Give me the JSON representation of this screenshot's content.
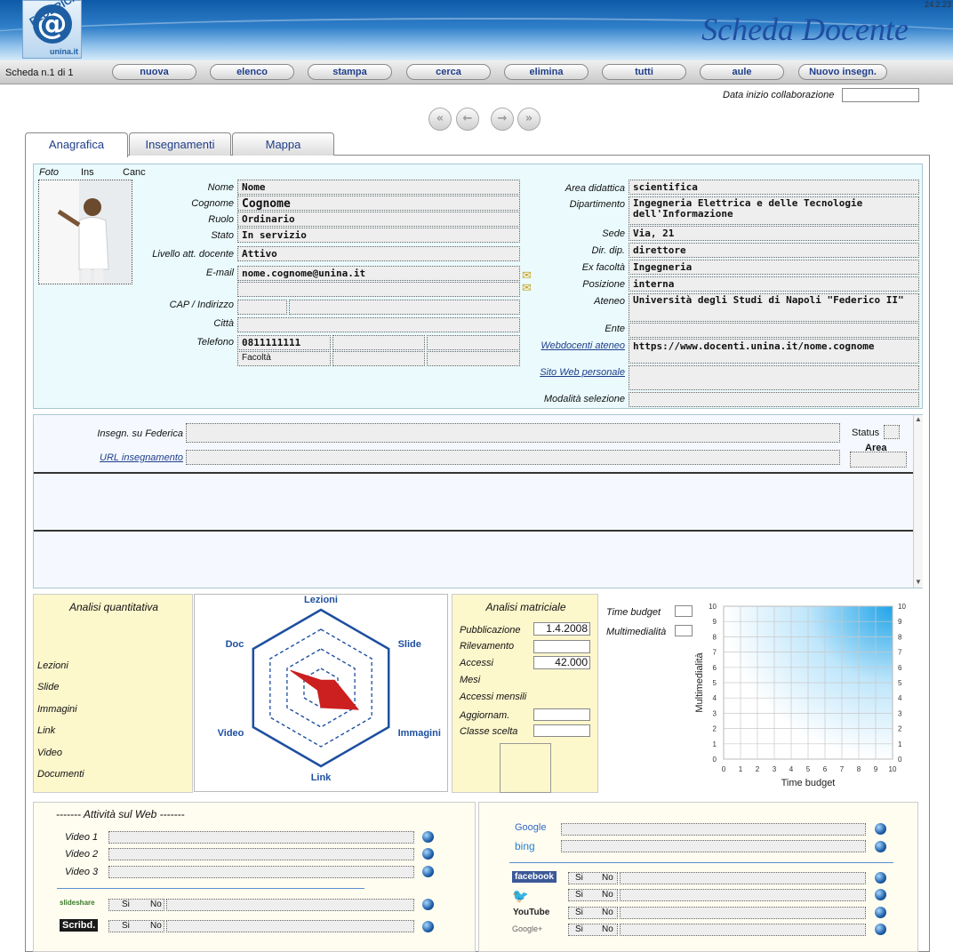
{
  "app": {
    "version": "24.2.23",
    "title": "Scheda Docente",
    "logo_top": "FEDERICA",
    "logo_bottom": "unina.it",
    "logo_glyph": "@"
  },
  "toolbar": {
    "record_label": "Scheda n.1  di 1",
    "buttons": [
      "nuova",
      "elenco",
      "stampa",
      "cerca",
      "elimina",
      "tutti",
      "aule",
      "Nuovo insegn."
    ]
  },
  "date_label": "Data inizio collaborazione",
  "nav_icons": [
    "first-record-icon",
    "prev-record-icon",
    "next-record-icon",
    "last-record-icon"
  ],
  "tabs": [
    "Anagrafica",
    "Insegnamenti",
    "Mappa"
  ],
  "photo": {
    "labels": [
      "Foto",
      "Ins",
      "Canc"
    ]
  },
  "left_fields": {
    "nome": {
      "label": "Nome",
      "value": "Nome"
    },
    "cognome": {
      "label": "Cognome",
      "value": "Cognome"
    },
    "ruolo": {
      "label": "Ruolo",
      "value": "Ordinario"
    },
    "stato": {
      "label": "Stato",
      "value": "In servizio"
    },
    "livello": {
      "label": "Livello att. docente",
      "value": "Attivo"
    },
    "email": {
      "label": "E-mail",
      "value": "nome.cognome@unina.it"
    },
    "cap": {
      "label": "CAP / Indirizzo"
    },
    "citta": {
      "label": "Città"
    },
    "telefono": {
      "label": "Telefono",
      "value": "0811111111",
      "sub": "Facoltà"
    }
  },
  "right_fields": {
    "area": {
      "label": "Area didattica",
      "value": "scientifica"
    },
    "dip": {
      "label": "Dipartimento",
      "value": "Ingegneria Elettrica e delle Tecnologie dell'Informazione"
    },
    "sede": {
      "label": "Sede",
      "value": "Via, 21"
    },
    "dirdip": {
      "label": "Dir. dip.",
      "value": "direttore"
    },
    "exfac": {
      "label": "Ex facoltà",
      "value": "Ingegneria"
    },
    "pos": {
      "label": "Posizione",
      "value": "interna"
    },
    "ateneo": {
      "label": "Ateneo",
      "value": "Università degli Studi di Napoli \"Federico II\""
    },
    "ente": {
      "label": "Ente"
    },
    "webdoc": {
      "label": "Webdocenti ateneo",
      "value": "https://www.docenti.unina.it/nome.cognome"
    },
    "sito": {
      "label": "Sito Web personale"
    },
    "modalita": {
      "label": "Modalità selezione"
    }
  },
  "insegnamenti": {
    "label": "Insegn. su Federica",
    "url_label": "URL insegnamento",
    "status": "Status",
    "area": "Area"
  },
  "quant": {
    "title": "Analisi quantitativa",
    "items": [
      "Lezioni",
      "Slide",
      "Immagini",
      "Link",
      "Video",
      "Documenti"
    ]
  },
  "radar": {
    "axes": [
      "Lezioni",
      "Slide",
      "Immagini",
      "Link",
      "Video",
      "Doc"
    ],
    "values": [
      0.1,
      0.2,
      0.55,
      0.25,
      0.05,
      0.45
    ],
    "color": "#cc1f1f"
  },
  "matr": {
    "title": "Analisi matriciale",
    "pub_label": "Pubblicazione",
    "pub_value": "1.4.2008",
    "ril_label": "Rilevamento",
    "acc_label": "Accessi",
    "acc_value": "42.000",
    "mesi_label": "Mesi",
    "accm_label": "Accessi mensili",
    "agg_label": "Aggiornam.",
    "classe_label": "Classe scelta"
  },
  "matrix": {
    "tb_label": "Time budget",
    "mm_label": "Multimedialità",
    "xlabel": "Time budget",
    "ylabel": "Multimedialità",
    "ticks": [
      "0",
      "1",
      "2",
      "3",
      "4",
      "5",
      "6",
      "7",
      "8",
      "9",
      "10"
    ]
  },
  "web": {
    "title": "------- Attività sul Web -------",
    "videos": [
      "Video 1",
      "Video 2",
      "Video 3"
    ],
    "si": "Si",
    "no": "No",
    "brands": [
      "slideshare",
      "Scribd.",
      "Google",
      "bing",
      "facebook",
      "twitter",
      "YouTube",
      "Google+"
    ]
  }
}
